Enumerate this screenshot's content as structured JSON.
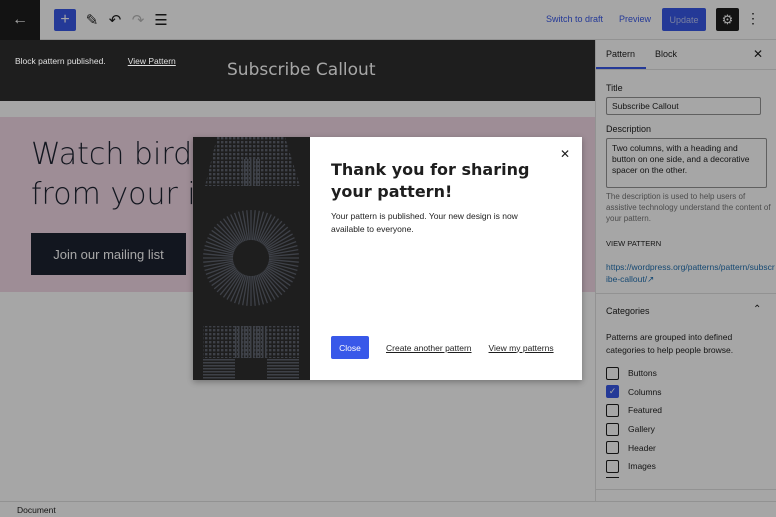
{
  "toolbar": {
    "back_icon": "arrow-left",
    "add_icon": "+",
    "tools_icon": "pencil",
    "undo_icon": "undo",
    "redo_icon": "redo",
    "list_view_icon": "list-view",
    "switch_to_draft": "Switch to draft",
    "preview": "Preview",
    "update": "Update",
    "settings_icon": "gear",
    "more_icon": "more-vertical",
    "accent_color": "#3858e9"
  },
  "canvas": {
    "document_title": "Subscribe Callout",
    "heading_line1": "Watch birds",
    "heading_line2": "from your inbox",
    "button_label": "Join our mailing list",
    "callout_bg": "#f3d9e6"
  },
  "snackbar": {
    "message": "Block pattern published.",
    "link": "View Pattern"
  },
  "modal": {
    "title": "Thank you for sharing your pattern!",
    "text": "Your pattern is published. Your new design is now available to everyone.",
    "close_label": "Close",
    "create_another": "Create another pattern",
    "view_my_patterns": "View my patterns"
  },
  "sidebar": {
    "tabs": [
      {
        "label": "Pattern",
        "active": true
      },
      {
        "label": "Block",
        "active": false
      }
    ],
    "title_label": "Title",
    "title_value": "Subscribe Callout",
    "description_label": "Description",
    "description_value": "Two columns, with a heading and button on one side, and a decorative spacer on the other.",
    "description_help": "The description is used to help users of assistive technology understand the content of your pattern.",
    "view_pattern_label": "VIEW PATTERN",
    "view_pattern_url": "https://wordpress.org/patterns/pattern/subscribe-callout/",
    "categories_title": "Categories",
    "categories_desc": "Patterns are grouped into defined categories to help people browse.",
    "categories": [
      {
        "label": "Buttons",
        "checked": false
      },
      {
        "label": "Columns",
        "checked": true
      },
      {
        "label": "Featured",
        "checked": false
      },
      {
        "label": "Gallery",
        "checked": false
      },
      {
        "label": "Header",
        "checked": false
      },
      {
        "label": "Images",
        "checked": false
      }
    ]
  },
  "footer": {
    "breadcrumb": "Document"
  }
}
